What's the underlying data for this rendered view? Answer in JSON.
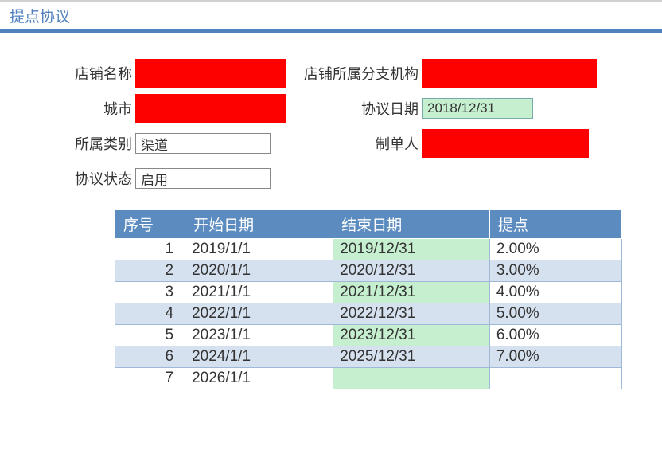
{
  "title": "提点协议",
  "form": {
    "shop_name_label": "店铺名称",
    "branch_label": "店铺所属分支机构",
    "city_label": "城市",
    "agreement_date_label": "协议日期",
    "agreement_date_value": "2018/12/31",
    "category_label": "所属类别",
    "category_value": "渠道",
    "creator_label": "制单人",
    "status_label": "协议状态",
    "status_value": "启用"
  },
  "table": {
    "headers": {
      "seq": "序号",
      "start": "开始日期",
      "end": "结束日期",
      "rate": "提点"
    },
    "rows": [
      {
        "seq": "1",
        "start": "2019/1/1",
        "end": "2019/12/31",
        "rate": "2.00%",
        "end_green": true
      },
      {
        "seq": "2",
        "start": "2020/1/1",
        "end": "2020/12/31",
        "rate": "3.00%",
        "end_green": false
      },
      {
        "seq": "3",
        "start": "2021/1/1",
        "end": "2021/12/31",
        "rate": "4.00%",
        "end_green": true
      },
      {
        "seq": "4",
        "start": "2022/1/1",
        "end": "2022/12/31",
        "rate": "5.00%",
        "end_green": false
      },
      {
        "seq": "5",
        "start": "2023/1/1",
        "end": "2023/12/31",
        "rate": "6.00%",
        "end_green": true
      },
      {
        "seq": "6",
        "start": "2024/1/1",
        "end": "2025/12/31",
        "rate": "7.00%",
        "end_green": false
      },
      {
        "seq": "7",
        "start": "2026/1/1",
        "end": "",
        "rate": "",
        "end_green": true
      }
    ]
  }
}
